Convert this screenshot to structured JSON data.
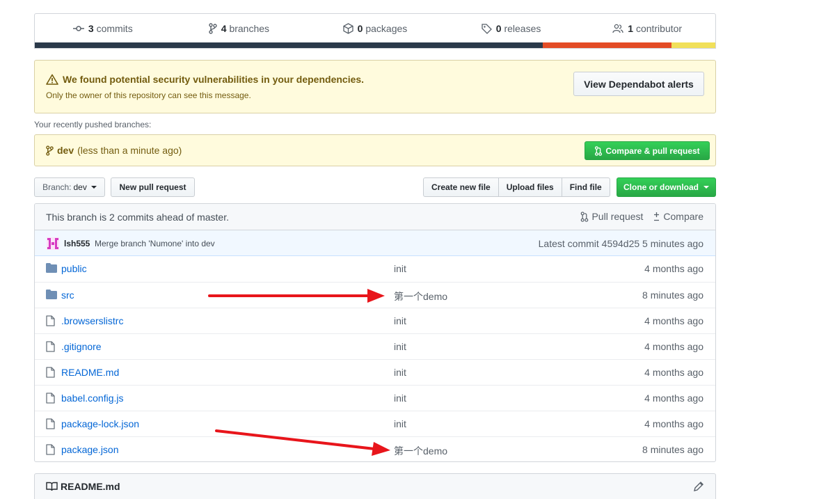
{
  "summary": {
    "commits_count": "3",
    "commits_label": "commits",
    "branches_count": "4",
    "branches_label": "branches",
    "packages_count": "0",
    "packages_label": "packages",
    "releases_count": "0",
    "releases_label": "releases",
    "contributors_count": "1",
    "contributors_label": "contributor",
    "language_colors": [
      "#2b3a4a",
      "#e34c26",
      "#f1e05a"
    ],
    "language_shares": [
      0.746,
      0.19,
      0.064
    ]
  },
  "security_alert": {
    "title": "We found potential security vulnerabilities in your dependencies.",
    "subtitle": "Only the owner of this repository can see this message.",
    "button": "View Dependabot alerts"
  },
  "recent_branches": {
    "label": "Your recently pushed branches:",
    "branch": "dev",
    "time": "(less than a minute ago)",
    "button": "Compare & pull request"
  },
  "file_nav": {
    "branch_label": "Branch:",
    "branch_value": "dev",
    "new_pull_request": "New pull request",
    "create_file": "Create new file",
    "upload_files": "Upload files",
    "find_file": "Find file",
    "clone": "Clone or download"
  },
  "branch_status": {
    "text": "This branch is 2 commits ahead of master.",
    "pull_request": "Pull request",
    "compare": "Compare"
  },
  "latest_commit": {
    "author": "lsh555",
    "message": "Merge branch 'Numone' into dev",
    "summary": "Latest commit 4594d25 5 minutes ago"
  },
  "files": [
    {
      "type": "folder",
      "name": "public",
      "message": "init",
      "age": "4 months ago"
    },
    {
      "type": "folder",
      "name": "src",
      "message": "第一个demo",
      "age": "8 minutes ago"
    },
    {
      "type": "file",
      "name": ".browserslistrc",
      "message": "init",
      "age": "4 months ago"
    },
    {
      "type": "file",
      "name": ".gitignore",
      "message": "init",
      "age": "4 months ago"
    },
    {
      "type": "file",
      "name": "README.md",
      "message": "init",
      "age": "4 months ago"
    },
    {
      "type": "file",
      "name": "babel.config.js",
      "message": "init",
      "age": "4 months ago"
    },
    {
      "type": "file",
      "name": "package-lock.json",
      "message": "init",
      "age": "4 months ago"
    },
    {
      "type": "file",
      "name": "package.json",
      "message": "第一个demo",
      "age": "8 minutes ago"
    }
  ],
  "readme": {
    "title": "README.md"
  },
  "colors": {
    "link": "#0366d6",
    "green": "#28a745",
    "annotation_arrow": "#e8151b"
  }
}
